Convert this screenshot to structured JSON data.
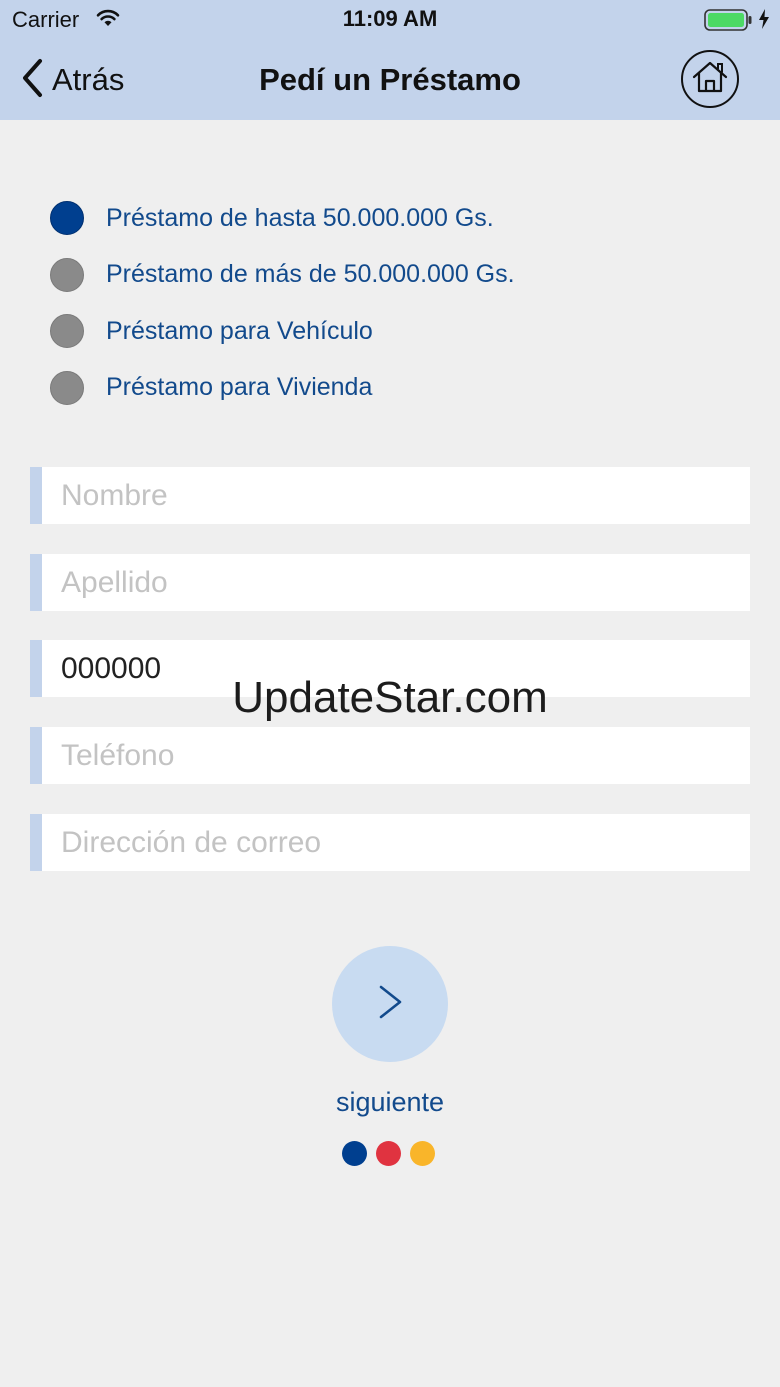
{
  "status_bar": {
    "carrier": "Carrier",
    "time": "11:09 AM",
    "battery_color": "#4cd964"
  },
  "nav": {
    "back_label": "Atrás",
    "title": "Pedí un Préstamo"
  },
  "loan_options": [
    {
      "label": "Préstamo de hasta 50.000.000 Gs.",
      "selected": true
    },
    {
      "label": "Préstamo de más de 50.000.000 Gs.",
      "selected": false
    },
    {
      "label": "Préstamo para Vehículo",
      "selected": false
    },
    {
      "label": "Préstamo para Vivienda",
      "selected": false
    }
  ],
  "form": {
    "nombre": {
      "placeholder": "Nombre",
      "value": ""
    },
    "apellido": {
      "placeholder": "Apellido",
      "value": ""
    },
    "documento": {
      "placeholder": "",
      "value": "000000"
    },
    "telefono": {
      "placeholder": "Teléfono",
      "value": ""
    },
    "correo": {
      "placeholder": "Dirección de correo",
      "value": ""
    }
  },
  "watermark": "UpdateStar.com",
  "next": {
    "symbol": ">",
    "label": "siguiente"
  },
  "brand_dots": [
    "#003f8f",
    "#e03340",
    "#f9b52a"
  ],
  "colors": {
    "header_bg": "#c3d3eb",
    "accent": "#003f8f",
    "text_blue": "#124a8c"
  }
}
